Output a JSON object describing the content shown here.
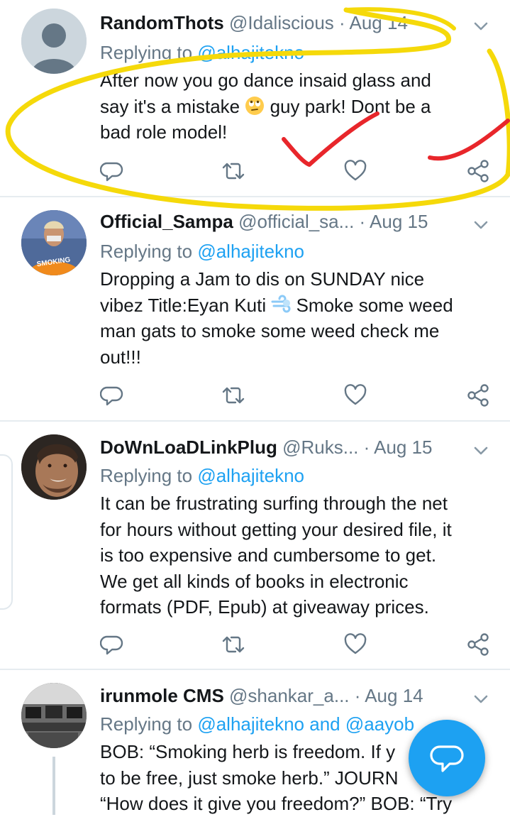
{
  "tweets": [
    {
      "name": "RandomThots",
      "handle": "@Idaliscious",
      "time": "Aug 14",
      "reply_prefix": "Replying to ",
      "reply_to": "@alhajitekno",
      "lines": [
        "After now you go dance insaid glass and",
        "guy park!  Dont be a",
        "bad role model!"
      ],
      "line2_prefix": "say it's a mistake "
    },
    {
      "name": "Official_Sampa",
      "handle": "@official_sa...",
      "time": "Aug 15",
      "reply_prefix": "Replying to ",
      "reply_to": "@alhajitekno",
      "lines": [
        "Dropping a Jam to dis on SUNDAY nice",
        "vibez Title:Eyan Kuti ",
        " Smoke some weed",
        "man gats to smoke some weed check me",
        "out!!!"
      ]
    },
    {
      "name": "DoWnLoaDLinkPlug",
      "handle": "@Ruks...",
      "time": "Aug 15",
      "reply_prefix": "Replying to ",
      "reply_to": "@alhajitekno",
      "lines": [
        "It can be frustrating surfing through the net",
        "for hours without getting your desired file,  it",
        "is too expensive and cumbersome to get.",
        "We get all kinds of books in electronic",
        "formats (PDF, Epub) at giveaway prices."
      ]
    },
    {
      "name": "irunmole CMS",
      "handle": "@shankar_a...",
      "time": "Aug 14",
      "reply_prefix": "Replying to ",
      "reply_to": "@alhajitekno and @aayob",
      "lines": [
        "BOB: “Smoking herb is freedom. If y",
        "to be free, just smoke herb.” JOURN",
        "“How does it give you freedom?” BOB: “Try"
      ]
    }
  ],
  "icons": {
    "reply": "reply-icon",
    "retweet": "retweet-icon",
    "like": "heart-icon",
    "share": "share-icon",
    "more": "chevron-down-icon",
    "compose": "compose-reply-icon"
  },
  "colors": {
    "accent": "#1da1f2",
    "secondary_text": "#657786",
    "annotation_yellow": "#f5d90a",
    "annotation_red": "#e8262b"
  }
}
